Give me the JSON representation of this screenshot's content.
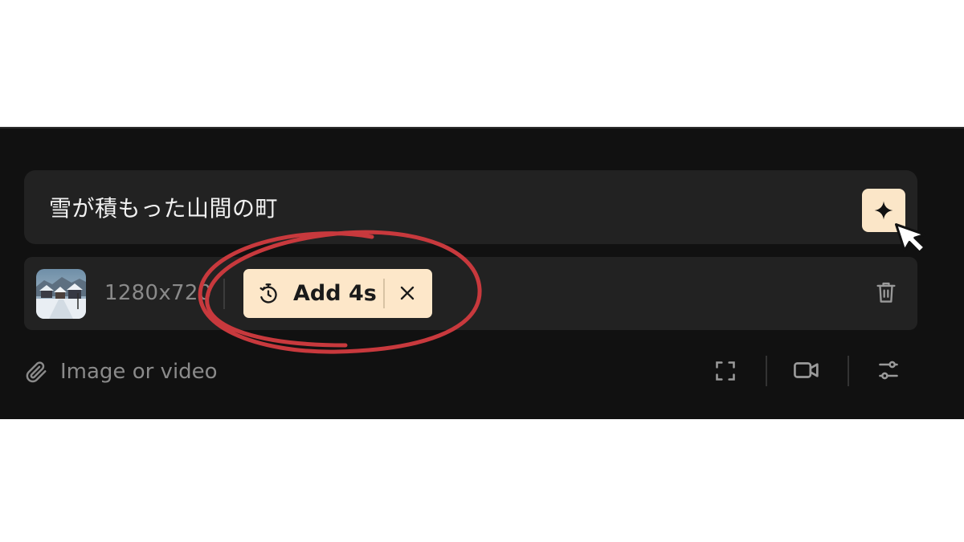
{
  "prompt": {
    "text": "雪が積もった山間の町",
    "generate_icon": "sparkle-icon"
  },
  "settings": {
    "resolution": "1280x720",
    "chip": {
      "icon": "timer-icon",
      "label": "Add 4s",
      "close_icon": "close-icon"
    },
    "delete_icon": "trash-icon"
  },
  "attachments": {
    "icon": "paperclip-icon",
    "label": "Image or video"
  },
  "toolbar": [
    "fullscreen-icon",
    "video-camera-icon",
    "sliders-icon"
  ],
  "colors": {
    "panel_bg": "#111111",
    "field_bg": "#222222",
    "accent": "#fde7c9",
    "annotation": "#c8393d"
  }
}
